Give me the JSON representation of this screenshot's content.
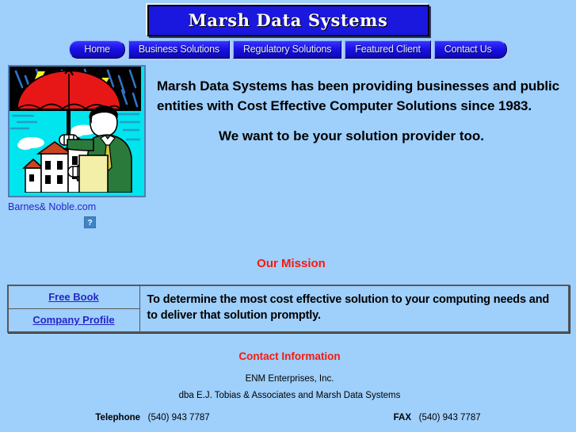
{
  "site": {
    "title": "Marsh Data Systems"
  },
  "nav": {
    "items": [
      {
        "label": "Home"
      },
      {
        "label": "Business Solutions"
      },
      {
        "label": "Regulatory Solutions"
      },
      {
        "label": "Featured Client"
      },
      {
        "label": "Contact Us"
      }
    ]
  },
  "hero": {
    "image_alt": "Man holding red umbrella over houses in a storm",
    "partner_link": "Barnes& Noble.com",
    "broken_image_glyph": "?",
    "intro": "Marsh Data Systems has been providing businesses and public entities with Cost Effective Computer Solutions since 1983.",
    "tagline": "We want to be your solution provider too."
  },
  "mission": {
    "heading": "Our Mission",
    "links": [
      {
        "label": "Free Book"
      },
      {
        "label": "Company Profile"
      }
    ],
    "statement": "To determine the most cost effective solution to your computing needs and to deliver that solution promptly."
  },
  "contact": {
    "heading": "Contact Information",
    "company": "ENM Enterprises, Inc.",
    "dba": "dba E.J. Tobias & Associates and Marsh Data Systems",
    "telephone_label": "Telephone",
    "telephone_value": "(540) 943 7787",
    "fax_label": "FAX",
    "fax_value": "(540) 943 7787"
  },
  "colors": {
    "page_background": "#9FCFFB",
    "title_blue": "#1A17DF",
    "nav_blue": "#1A12E6",
    "link_blue": "#2626C8",
    "heading_red": "#F8190D",
    "table_border": "#585858"
  }
}
